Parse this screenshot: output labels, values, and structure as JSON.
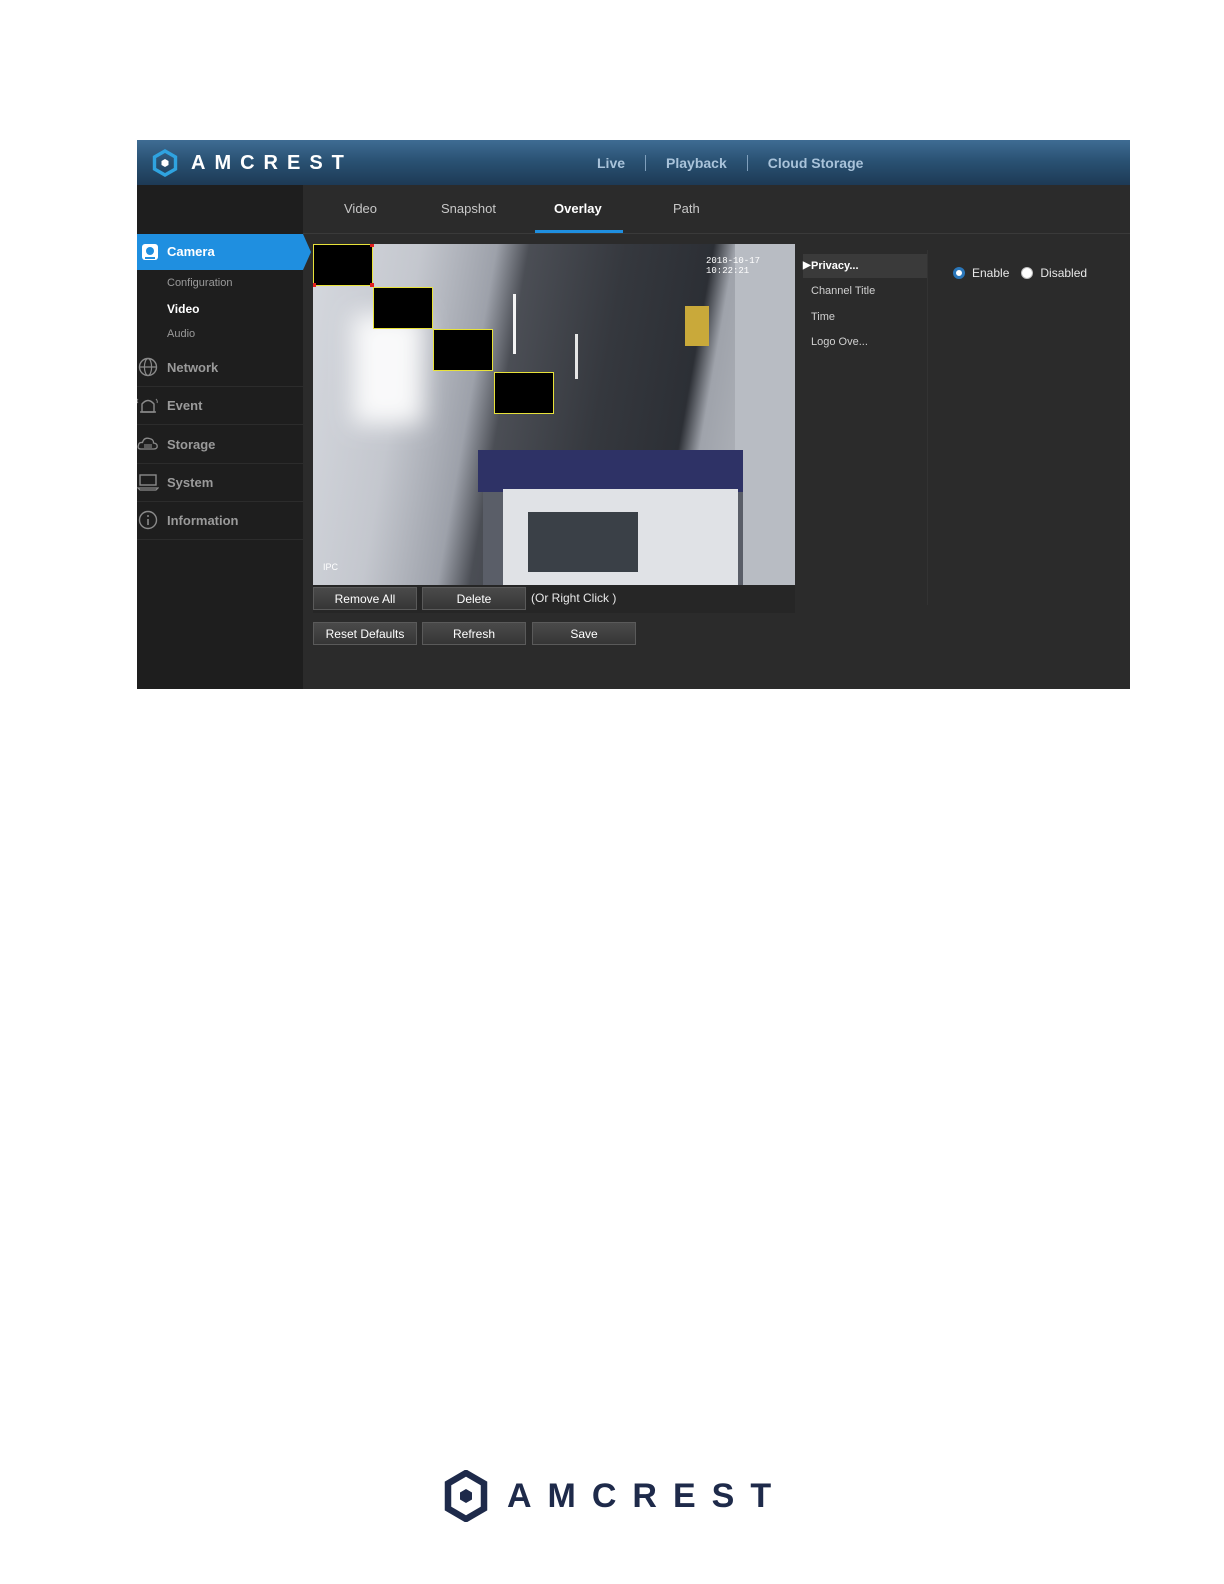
{
  "brand": {
    "name": "AMCREST"
  },
  "topnav": {
    "live": "Live",
    "playback": "Playback",
    "cloud_storage": "Cloud Storage"
  },
  "tabs": {
    "video": "Video",
    "snapshot": "Snapshot",
    "overlay": "Overlay",
    "path": "Path",
    "active": "Overlay"
  },
  "sidebar": {
    "camera": "Camera",
    "camera_sub": {
      "configuration": "Configuration",
      "video": "Video",
      "audio": "Audio"
    },
    "network": "Network",
    "event": "Event",
    "storage": "Storage",
    "system": "System",
    "information": "Information"
  },
  "video": {
    "timestamp": "2018-10-17 10:22:21",
    "channel_label": "IPC",
    "privacy_masks": 4
  },
  "toolbar": {
    "remove_all": "Remove All",
    "delete": "Delete",
    "hint": "(Or Right Click )",
    "reset_defaults": "Reset Defaults",
    "refresh": "Refresh",
    "save": "Save"
  },
  "overlay_list": {
    "items": [
      "Privacy...",
      "Channel Title",
      "Time",
      "Logo Ove..."
    ],
    "active": "Privacy..."
  },
  "privacy": {
    "enable": "Enable",
    "disabled": "Disabled",
    "selected": "Enable"
  },
  "colors": {
    "accent": "#1f8fe0",
    "mask_border": "#e8e23a",
    "sidebar_bg": "#1e1e1e",
    "panel_bg": "#2b2b2b"
  }
}
